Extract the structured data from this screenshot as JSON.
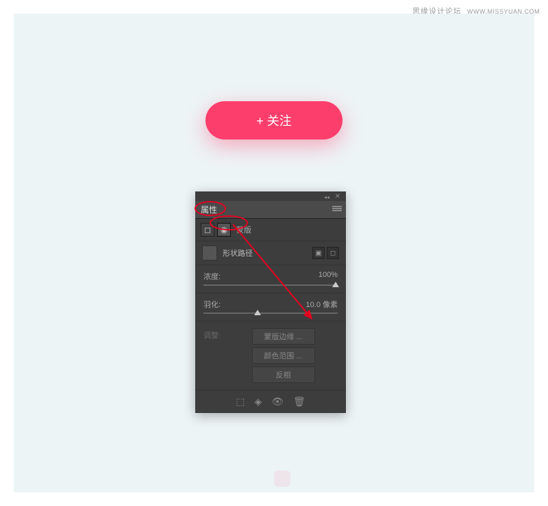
{
  "watermark": {
    "text": "思缘设计论坛",
    "url": "WWW.MISSYUAN.COM"
  },
  "button": {
    "label": "+ 关注"
  },
  "panel": {
    "tab": "属性",
    "mask_label": "蒙版",
    "shape_path": "形状路径",
    "density": {
      "label": "浓度:",
      "value": "100%"
    },
    "feather": {
      "label": "羽化:",
      "value": "10.0 像素"
    },
    "adjust": {
      "label": "调整:",
      "btn_mask_edge": "蒙版边缘 ...",
      "btn_color_range": "颜色范围 ...",
      "btn_invert": "反相"
    }
  },
  "slider_positions": {
    "density_pct": 96,
    "feather_pct": 38
  }
}
